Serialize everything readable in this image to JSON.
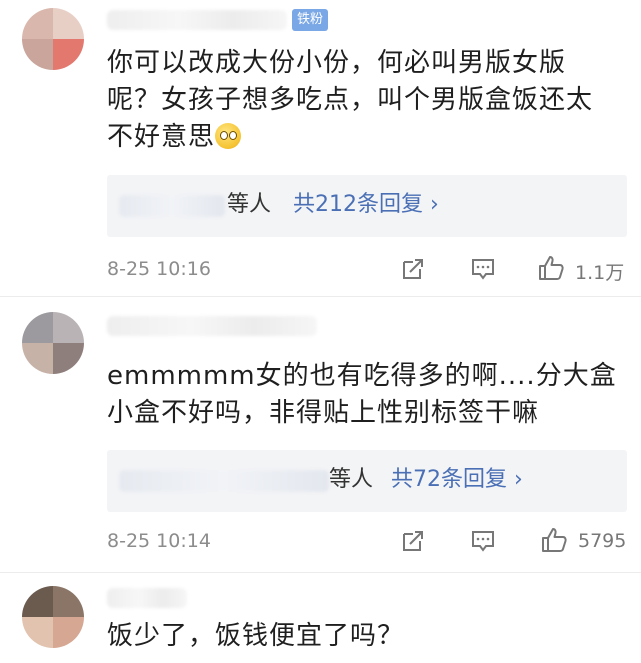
{
  "comments": [
    {
      "badge": "铁粉",
      "text": "你可以改成大份小份，何必叫男版女版呢？女孩子想多吃点，叫个男版盒饭还太不好意思",
      "emoji": "eye-roll-emoji",
      "reply_suffix": "等人",
      "reply_count": "共212条回复 ›",
      "time": "8-25 10:16",
      "likes": "1.1万"
    },
    {
      "text": "emmmmm女的也有吃得多的啊....分大盒小盒不好吗，非得贴上性别标签干嘛",
      "reply_suffix": "等人",
      "reply_count": "共72条回复 ›",
      "time": "8-25 10:14",
      "likes": "5795"
    },
    {
      "text": "饭少了，饭钱便宜了吗？"
    }
  ],
  "icons": [
    "share-icon",
    "comment-icon",
    "like-icon"
  ],
  "colors": {
    "link": "#4a6fb5",
    "badge": "#7aa7e6",
    "meta": "#8c8c8c",
    "reply_bg": "#f3f4f6"
  }
}
